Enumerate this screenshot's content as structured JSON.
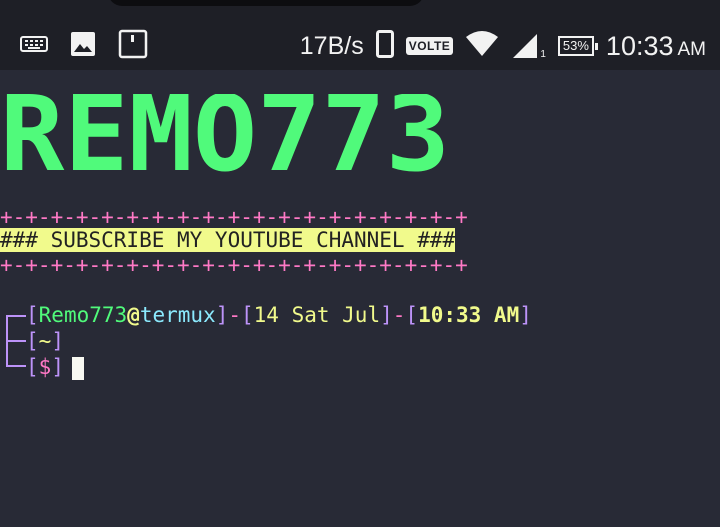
{
  "status_bar": {
    "net_speed": "17B/s",
    "volte": "VOLTE",
    "signal_suffix": "1",
    "battery": "53%",
    "time": "10:33",
    "ampm": "AM",
    "icons": [
      "keyboard-icon",
      "image-icon",
      "screenshot-icon",
      "phone-icon",
      "wifi-icon",
      "signal-icon",
      "battery-icon"
    ]
  },
  "terminal": {
    "banner_text": "REMO773",
    "separator_top": "+-+-+-+-+-+-+-+-+-+-+-+-+-+-+-+-+-+-+",
    "subscribe": "### SUBSCRIBE MY YOUTUBE CHANNEL ###",
    "separator_bottom": "+-+-+-+-+-+-+-+-+-+-+-+-+-+-+-+-+-+-+",
    "prompt": {
      "user": "Remo773",
      "at": "@",
      "host": "termux",
      "date": "14 Sat Jul",
      "time": "10:33 AM",
      "dir": "~",
      "symbol": "$"
    },
    "colors": {
      "background": "#282a36",
      "banner": "#50fa7b",
      "separator": "#ff79c6",
      "highlight": "#f1fa8c"
    }
  }
}
